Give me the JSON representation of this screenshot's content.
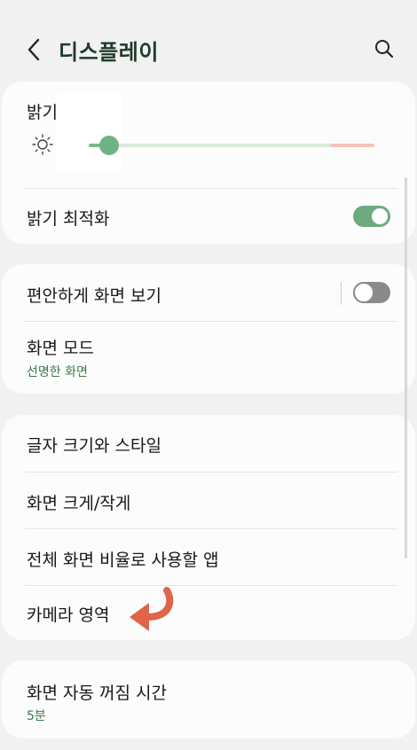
{
  "header": {
    "title": "디스플레이",
    "back_icon": "chevron-left-icon",
    "search_icon": "search-icon"
  },
  "brightness": {
    "label": "밝기",
    "level_percent": 7,
    "sun_icon": "sun-icon"
  },
  "adaptive_brightness": {
    "label": "밝기 최적화",
    "enabled": true
  },
  "eye_comfort": {
    "label": "편안하게 화면 보기",
    "enabled": false
  },
  "screen_mode": {
    "label": "화면 모드",
    "value": "선명한 화면"
  },
  "font_size": {
    "label": "글자 크기와 스타일"
  },
  "screen_zoom": {
    "label": "화면 크게/작게"
  },
  "full_screen_apps": {
    "label": "전체 화면 비율로 사용할 앱"
  },
  "camera_cutout": {
    "label": "카메라 영역",
    "annotation_icon": "curved-arrow-icon"
  },
  "screen_timeout": {
    "label": "화면 자동 꺼짐 시간",
    "value": "5분"
  },
  "colors": {
    "accent": "#3b7a4a",
    "toggle_on": "#6eaa7f",
    "slider": "#6eb482",
    "annotation_arrow": "#e0644a"
  }
}
